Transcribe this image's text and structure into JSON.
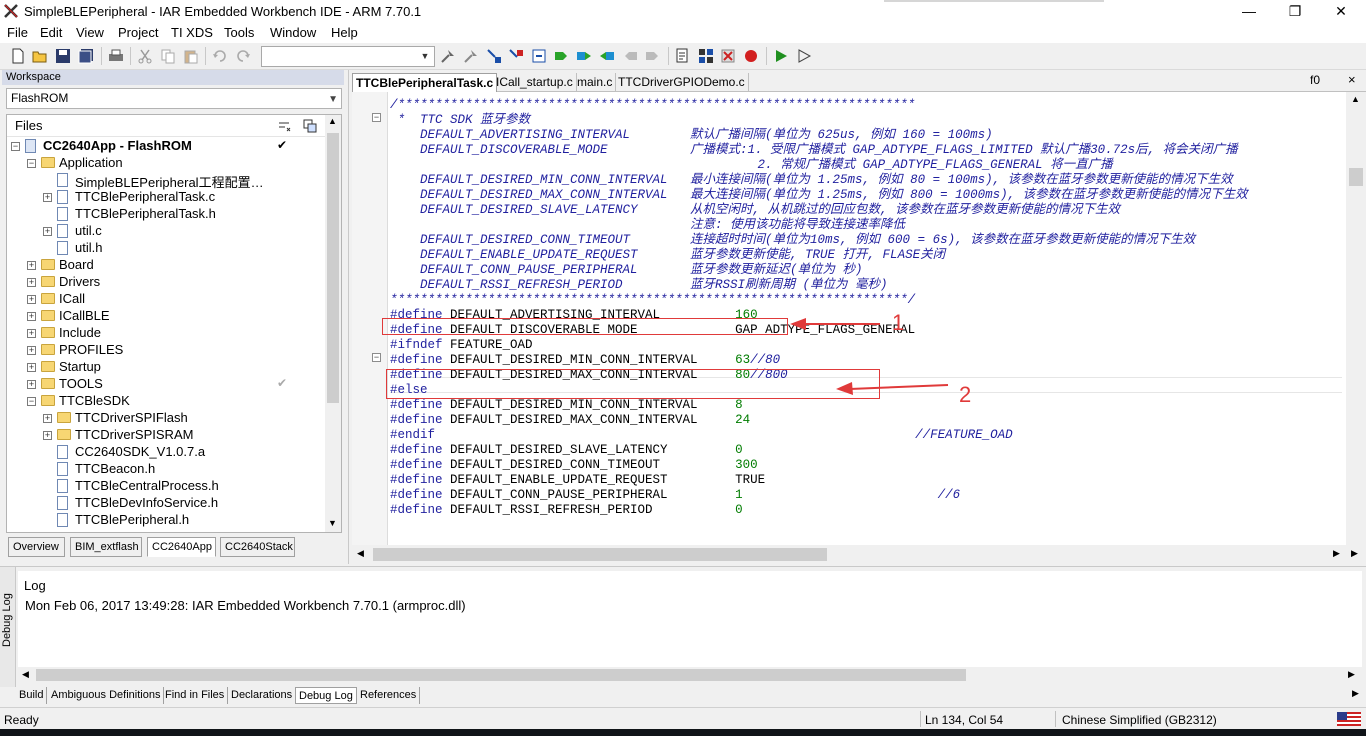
{
  "window": {
    "title": "SimpleBLEPeripheral - IAR Embedded Workbench IDE - ARM 7.70.1",
    "minimize": "—",
    "maximize": "❐",
    "close": "✕"
  },
  "menu": [
    "File",
    "Edit",
    "View",
    "Project",
    "TI XDS",
    "Tools",
    "Window",
    "Help"
  ],
  "workspace": {
    "header": "Workspace",
    "config": "FlashROM",
    "files_label": "Files",
    "tree": [
      {
        "label": "CC2640App - FlashROM",
        "level": 0,
        "type": "project",
        "expand": "−",
        "bold": true
      },
      {
        "label": "Application",
        "level": 1,
        "type": "folder",
        "expand": "−"
      },
      {
        "label": "SimpleBLEPeripheral工程配置…",
        "level": 2,
        "type": "file",
        "expand": ""
      },
      {
        "label": "TTCBlePeripheralTask.c",
        "level": 2,
        "type": "file",
        "expand": "+"
      },
      {
        "label": "TTCBlePeripheralTask.h",
        "level": 2,
        "type": "file",
        "expand": ""
      },
      {
        "label": "util.c",
        "level": 2,
        "type": "file",
        "expand": "+"
      },
      {
        "label": "util.h",
        "level": 2,
        "type": "file",
        "expand": ""
      },
      {
        "label": "Board",
        "level": 1,
        "type": "folder",
        "expand": "+"
      },
      {
        "label": "Drivers",
        "level": 1,
        "type": "folder",
        "expand": "+"
      },
      {
        "label": "ICall",
        "level": 1,
        "type": "folder",
        "expand": "+"
      },
      {
        "label": "ICallBLE",
        "level": 1,
        "type": "folder",
        "expand": "+"
      },
      {
        "label": "Include",
        "level": 1,
        "type": "folder",
        "expand": "+"
      },
      {
        "label": "PROFILES",
        "level": 1,
        "type": "folder",
        "expand": "+"
      },
      {
        "label": "Startup",
        "level": 1,
        "type": "folder",
        "expand": "+"
      },
      {
        "label": "TOOLS",
        "level": 1,
        "type": "folder",
        "expand": "+"
      },
      {
        "label": "TTCBleSDK",
        "level": 1,
        "type": "folder",
        "expand": "−"
      },
      {
        "label": "TTCDriverSPIFlash",
        "level": 2,
        "type": "folder",
        "expand": "+"
      },
      {
        "label": "TTCDriverSPISRAM",
        "level": 2,
        "type": "folder",
        "expand": "+"
      },
      {
        "label": "CC2640SDK_V1.0.7.a",
        "level": 2,
        "type": "file",
        "expand": ""
      },
      {
        "label": "TTCBeacon.h",
        "level": 2,
        "type": "file",
        "expand": ""
      },
      {
        "label": "TTCBleCentralProcess.h",
        "level": 2,
        "type": "file",
        "expand": ""
      },
      {
        "label": "TTCBleDevInfoService.h",
        "level": 2,
        "type": "file",
        "expand": ""
      },
      {
        "label": "TTCBlePeripheral.h",
        "level": 2,
        "type": "file",
        "expand": ""
      }
    ],
    "tabs": [
      "Overview",
      "BIM_extflash",
      "CC2640App",
      "CC2640Stack"
    ],
    "active_tab": "CC2640App"
  },
  "editor": {
    "tabs": [
      "TTCBlePeripheralTask.c",
      "ICall_startup.c",
      "main.c",
      "TTCDriverGPIODemo.c"
    ],
    "active_tab": "TTCBlePeripheralTask.c",
    "function_box": "f0",
    "close": "×",
    "lines": [
      {
        "segs": [
          [
            "c-cmt",
            "/*********************************************************************"
          ]
        ]
      },
      {
        "segs": [
          [
            "c-cmt",
            " *  TTC SDK 蓝牙参数"
          ]
        ]
      },
      {
        "segs": [
          [
            "c-cmt",
            "    DEFAULT_ADVERTISING_INTERVAL        默认广播间隔(单位为 625us, 例如 160 = 100ms)"
          ]
        ]
      },
      {
        "segs": [
          [
            "c-cmt",
            "    DEFAULT_DISCOVERABLE_MODE           广播模式:1. 受限广播模式 GAP_ADTYPE_FLAGS_LIMITED 默认广播30.72s后, 将会关闭广播"
          ]
        ]
      },
      {
        "segs": [
          [
            "c-cmt",
            "                                                 2. 常规广播模式 GAP_ADTYPE_FLAGS_GENERAL 将一直广播"
          ]
        ]
      },
      {
        "segs": [
          [
            "c-cmt",
            "    DEFAULT_DESIRED_MIN_CONN_INTERVAL   最小连接间隔(单位为 1.25ms, 例如 80 = 100ms), 该参数在蓝牙参数更新使能的情况下生效"
          ]
        ]
      },
      {
        "segs": [
          [
            "c-cmt",
            "    DEFAULT_DESIRED_MAX_CONN_INTERVAL   最大连接间隔(单位为 1.25ms, 例如 800 = 1000ms), 该参数在蓝牙参数更新使能的情况下生效"
          ]
        ]
      },
      {
        "segs": [
          [
            "c-cmt",
            "    DEFAULT_DESIRED_SLAVE_LATENCY       从机空闲时, 从机跳过的回应包数, 该参数在蓝牙参数更新使能的情况下生效"
          ]
        ]
      },
      {
        "segs": [
          [
            "c-cmt",
            "                                        注意: 使用该功能将导致连接速率降低"
          ]
        ]
      },
      {
        "segs": [
          [
            "c-cmt",
            "    DEFAULT_DESIRED_CONN_TIMEOUT        连接超时时间(单位为10ms, 例如 600 = 6s), 该参数在蓝牙参数更新使能的情况下生效"
          ]
        ]
      },
      {
        "segs": [
          [
            "c-cmt",
            "    DEFAULT_ENABLE_UPDATE_REQUEST       蓝牙参数更新使能, TRUE 打开, FLASE关闭"
          ]
        ]
      },
      {
        "segs": [
          [
            "c-cmt",
            "    DEFAULT_CONN_PAUSE_PERIPHERAL       蓝牙参数更新延迟(单位为 秒)"
          ]
        ]
      },
      {
        "segs": [
          [
            "c-cmt",
            "    DEFAULT_RSSI_REFRESH_PERIOD         蓝牙RSSI刷新周期 (单位为 毫秒)"
          ]
        ]
      },
      {
        "segs": [
          [
            "c-cmt",
            "*********************************************************************/"
          ]
        ]
      },
      {
        "segs": [
          [
            "c-kw",
            "#define"
          ],
          [
            "c-id",
            " DEFAULT_ADVERTISING_INTERVAL          "
          ],
          [
            "c-num",
            "160"
          ]
        ]
      },
      {
        "segs": [
          [
            "c-kw",
            "#define"
          ],
          [
            "c-id",
            " DEFAULT_DISCOVERABLE_MODE             GAP_ADTYPE_FLAGS_GENERAL"
          ]
        ]
      },
      {
        "segs": [
          [
            "c-kw",
            "#ifndef"
          ],
          [
            "c-id",
            " FEATURE_OAD"
          ]
        ]
      },
      {
        "segs": [
          [
            "c-kw",
            "#define"
          ],
          [
            "c-id",
            " DEFAULT_DESIRED_MIN_CONN_INTERVAL     "
          ],
          [
            "c-num",
            "63"
          ],
          [
            "c-cmt2",
            "//80"
          ]
        ]
      },
      {
        "segs": [
          [
            "c-kw",
            "#define"
          ],
          [
            "c-id",
            " DEFAULT_DESIRED_MAX_CONN_INTERVAL     "
          ],
          [
            "c-num",
            "80"
          ],
          [
            "c-cmt2",
            "//800"
          ]
        ]
      },
      {
        "segs": [
          [
            "c-kw",
            "#else"
          ]
        ]
      },
      {
        "segs": [
          [
            "c-kw",
            "#define"
          ],
          [
            "c-id",
            " DEFAULT_DESIRED_MIN_CONN_INTERVAL     "
          ],
          [
            "c-num",
            "8"
          ]
        ]
      },
      {
        "segs": [
          [
            "c-kw",
            "#define"
          ],
          [
            "c-id",
            " DEFAULT_DESIRED_MAX_CONN_INTERVAL     "
          ],
          [
            "c-num",
            "24"
          ]
        ]
      },
      {
        "segs": [
          [
            "c-kw",
            "#endif"
          ],
          [
            "c-id",
            "                                                                "
          ],
          [
            "c-cmt2",
            "//FEATURE_OAD"
          ]
        ]
      },
      {
        "segs": [
          [
            "c-kw",
            "#define"
          ],
          [
            "c-id",
            " DEFAULT_DESIRED_SLAVE_LATENCY         "
          ],
          [
            "c-num",
            "0"
          ]
        ]
      },
      {
        "segs": [
          [
            "c-kw",
            "#define"
          ],
          [
            "c-id",
            " DEFAULT_DESIRED_CONN_TIMEOUT          "
          ],
          [
            "c-num",
            "300"
          ]
        ]
      },
      {
        "segs": [
          [
            "c-kw",
            "#define"
          ],
          [
            "c-id",
            " DEFAULT_ENABLE_UPDATE_REQUEST         TRUE"
          ]
        ]
      },
      {
        "segs": [
          [
            "c-kw",
            "#define"
          ],
          [
            "c-id",
            " DEFAULT_CONN_PAUSE_PERIPHERAL         "
          ],
          [
            "c-num",
            "1"
          ],
          [
            "c-id",
            "                          "
          ],
          [
            "c-cmt2",
            "//6"
          ]
        ]
      },
      {
        "segs": [
          [
            "c-kw",
            "#define"
          ],
          [
            "c-id",
            " DEFAULT_RSSI_REFRESH_PERIOD           "
          ],
          [
            "c-num",
            "0"
          ]
        ]
      }
    ]
  },
  "annotations": {
    "label1": "1",
    "label2": "2",
    "color": "#e03a3a"
  },
  "log": {
    "side_label": "Debug Log",
    "header": "Log",
    "line": "Mon Feb 06, 2017 13:49:28: IAR Embedded Workbench 7.70.1 (armproc.dll)",
    "tabs": [
      "Build",
      "Ambiguous Definitions",
      "Find in Files",
      "Declarations",
      "Debug Log",
      "References"
    ],
    "active_tab": "Debug Log"
  },
  "status": {
    "ready": "Ready",
    "position": "Ln 134, Col 54",
    "encoding": "Chinese Simplified (GB2312)"
  },
  "icons": [
    "app-icon",
    "new-file-icon",
    "open-icon",
    "save-icon",
    "save-all-icon",
    "print-icon",
    "cut-icon",
    "copy-icon",
    "paste-icon",
    "undo-icon",
    "redo-icon",
    "find-icon",
    "make-icon",
    "debug-icon",
    "breakpoint-icon",
    "flag-us-icon"
  ]
}
